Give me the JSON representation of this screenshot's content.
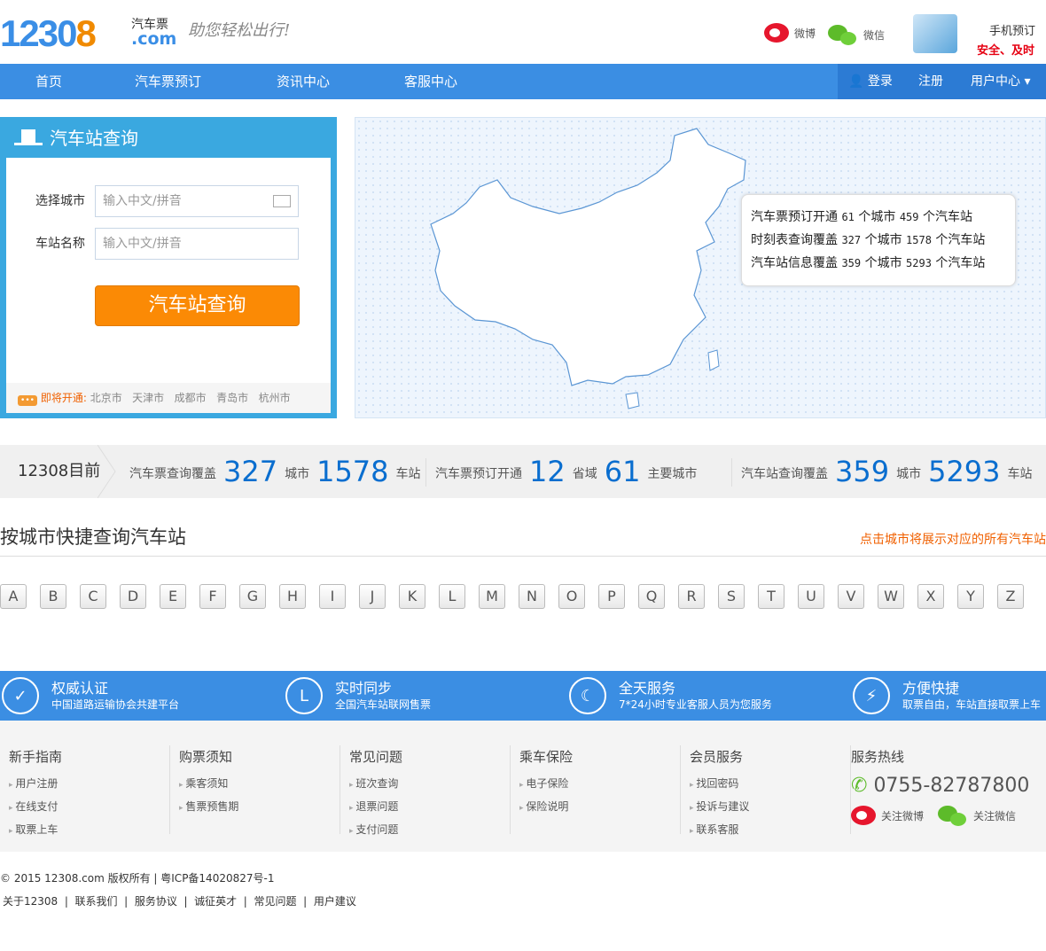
{
  "header": {
    "logo": "12308",
    "logo_sub": "汽车票",
    "logo_domain": ".com",
    "slogan": "助您轻松出行!",
    "weibo": "微博",
    "weixin": "微信",
    "mobile_title": "手机预订",
    "mobile_sub": "安全、及时"
  },
  "nav": {
    "items": [
      "首页",
      "汽车票预订",
      "资讯中心",
      "客服中心"
    ],
    "login": "登录",
    "register": "注册",
    "user_center": "用户中心"
  },
  "search": {
    "title": "汽车站查询",
    "city_label": "选择城市",
    "city_placeholder": "输入中文/拼音",
    "station_label": "车站名称",
    "station_placeholder": "输入中文/拼音",
    "button": "汽车站查询",
    "soon_label": "即将开通:",
    "soon_cities": [
      "北京市",
      "天津市",
      "成都市",
      "青岛市",
      "杭州市"
    ]
  },
  "map_info": [
    {
      "label": "汽车票预订开通",
      "n1": "61",
      "u1": "个城市",
      "n2": "459",
      "u2": "个汽车站"
    },
    {
      "label": "时刻表查询覆盖",
      "n1": "327",
      "u1": "个城市",
      "n2": "1578",
      "u2": "个汽车站"
    },
    {
      "label": "汽车站信息覆盖",
      "n1": "359",
      "u1": "个城市",
      "n2": "5293",
      "u2": "个汽车站"
    }
  ],
  "stats": {
    "lead": "12308目前",
    "g1": {
      "label": "汽车票查询覆盖",
      "n1": "327",
      "u1": "城市",
      "n2": "1578",
      "u2": "车站"
    },
    "g2": {
      "label": "汽车票预订开通",
      "n1": "12",
      "u1": "省域",
      "n2": "61",
      "u2": "主要城市"
    },
    "g3": {
      "label": "汽车站查询覆盖",
      "n1": "359",
      "u1": "城市",
      "n2": "5293",
      "u2": "车站"
    }
  },
  "quick": {
    "title": "按城市快捷查询汽车站",
    "hint": "点击城市将展示对应的所有汽车站",
    "letters": [
      "A",
      "B",
      "C",
      "D",
      "E",
      "F",
      "G",
      "H",
      "I",
      "J",
      "K",
      "L",
      "M",
      "N",
      "O",
      "P",
      "Q",
      "R",
      "S",
      "T",
      "U",
      "V",
      "W",
      "X",
      "Y",
      "Z"
    ]
  },
  "features": [
    {
      "title": "权威认证",
      "sub": "中国道路运输协会共建平台",
      "icon": "shield-icon"
    },
    {
      "title": "实时同步",
      "sub": "全国汽车站联网售票",
      "icon": "clock-icon"
    },
    {
      "title": "全天服务",
      "sub": "7*24小时专业客服人员为您服务",
      "icon": "moon-icon"
    },
    {
      "title": "方便快捷",
      "sub": "取票自由，车站直接取票上车",
      "icon": "lightning-icon"
    }
  ],
  "footer_cols": [
    {
      "title": "新手指南",
      "items": [
        "用户注册",
        "在线支付",
        "取票上车"
      ]
    },
    {
      "title": "购票须知",
      "items": [
        "乘客须知",
        "售票预售期"
      ]
    },
    {
      "title": "常见问题",
      "items": [
        "班次查询",
        "退票问题",
        "支付问题"
      ]
    },
    {
      "title": "乘车保险",
      "items": [
        "电子保险",
        "保险说明"
      ]
    },
    {
      "title": "会员服务",
      "items": [
        "找回密码",
        "投诉与建议",
        "联系客服"
      ]
    }
  ],
  "hotline": {
    "title": "服务热线",
    "phone": "0755-82787800",
    "weibo": "关注微博",
    "weixin": "关注微信"
  },
  "copyright": "© 2015 12308.com 版权所有 |  粤ICP备14020827号-1",
  "bottom_links": [
    "关于12308",
    "联系我们",
    "服务协议",
    "诚征英才",
    "常见问题",
    "用户建议"
  ]
}
